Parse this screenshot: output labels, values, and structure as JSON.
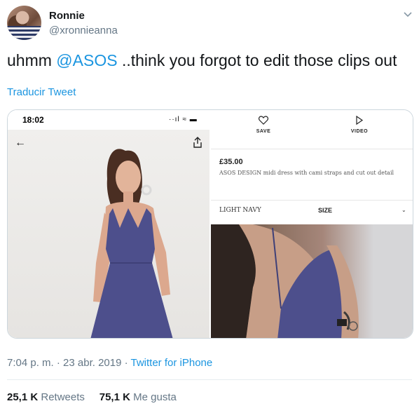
{
  "author": {
    "display_name": "Ronnie",
    "handle": "@xronnieanna"
  },
  "tweet": {
    "text_before": "uhmm ",
    "mention": "@ASOS",
    "text_after": " ..think you forgot to edit those clips out",
    "translate_label": "Traducir Tweet"
  },
  "screenshot_left": {
    "status_time": "18:02",
    "status_icons": "··ıl ≈ ▬"
  },
  "screenshot_right": {
    "save_label": "SAVE",
    "video_label": "VIDEO",
    "price": "£35.00",
    "description": "ASOS DESIGN midi dress with cami straps and cut out detail",
    "color": "LIGHT NAVY",
    "size_label": "SIZE"
  },
  "meta": {
    "time_date": "7:04 p. m. · 23 abr. 2019 · ",
    "source": "Twitter for iPhone"
  },
  "stats": {
    "retweets_count": "25,1 K",
    "retweets_label": "Retweets",
    "likes_count": "75,1 K",
    "likes_label": "Me gusta"
  },
  "colors": {
    "link": "#1b95e0",
    "secondary_text": "#657786",
    "dress": "#4d4f8c"
  }
}
